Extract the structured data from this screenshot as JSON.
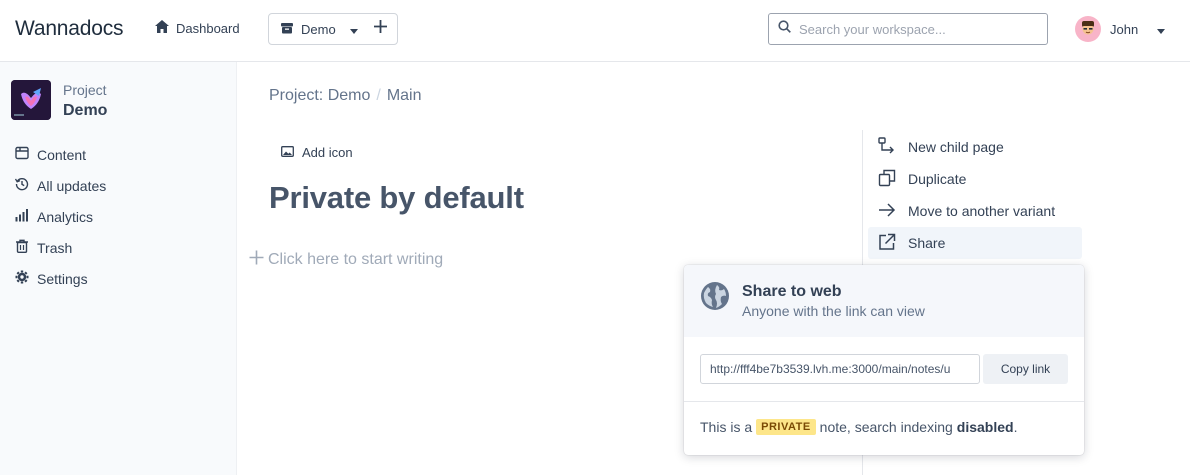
{
  "app": {
    "name": "Wannadocs"
  },
  "header": {
    "dashboard_label": "Dashboard",
    "variant_label": "Demo",
    "search_placeholder": "Search your workspace...",
    "user_name": "John"
  },
  "sidebar": {
    "project_label": "Project",
    "project_name": "Demo",
    "items": [
      {
        "label": "Content",
        "icon": "content-icon"
      },
      {
        "label": "All updates",
        "icon": "history-icon"
      },
      {
        "label": "Analytics",
        "icon": "analytics-icon"
      },
      {
        "label": "Trash",
        "icon": "trash-icon"
      },
      {
        "label": "Settings",
        "icon": "gear-icon"
      }
    ]
  },
  "main": {
    "breadcrumb": [
      "Project: Demo",
      "Main"
    ],
    "add_icon_label": "Add icon",
    "title": "Private by default",
    "editor_placeholder": "Click here to start writing"
  },
  "actions": [
    {
      "label": "New child page",
      "icon": "child-page-icon"
    },
    {
      "label": "Duplicate",
      "icon": "duplicate-icon"
    },
    {
      "label": "Move to another variant",
      "icon": "arrow-right-icon"
    },
    {
      "label": "Share",
      "icon": "external-link-icon"
    }
  ],
  "share": {
    "title": "Share to web",
    "subtitle": "Anyone with the link can view",
    "link": "http://fff4be7b3539.lvh.me:3000/main/notes/u",
    "copy_label": "Copy link",
    "notice_prefix": "This is a",
    "badge": "PRIVATE",
    "notice_middle": "note, search indexing",
    "notice_status": "disabled",
    "notice_end": ".",
    "badge_color": "#fde68a"
  }
}
